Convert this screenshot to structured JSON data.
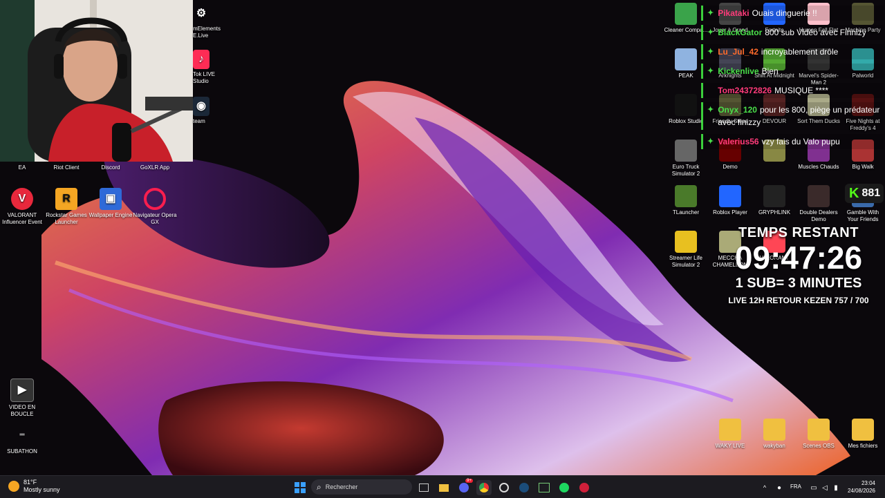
{
  "desktop_left_icons": [
    {
      "name": "ea-icon",
      "label": "EA",
      "color": "#ff4747"
    },
    {
      "name": "riot-client-icon",
      "label": "Riot Client",
      "color": "#e84040"
    },
    {
      "name": "discord-icon",
      "label": "Discord",
      "color": "#5865f2"
    },
    {
      "name": "goxlr-icon",
      "label": "GoXLR App",
      "color": "#222"
    },
    {
      "name": "valorant-influencer-icon",
      "label": "VALORANT Influencer Event",
      "color": "#ff4655"
    },
    {
      "name": "rockstar-icon",
      "label": "Rockstar Games Launcher",
      "color": "#f5a623"
    },
    {
      "name": "wallpaper-engine-icon",
      "label": "Wallpaper Engine",
      "color": "#2f6ad8"
    },
    {
      "name": "opera-gx-icon",
      "label": "Navigateur Opera GX",
      "color": "#fa1e4e"
    },
    {
      "name": "video-en-boucle-icon",
      "label": "VIDEO EN BOUCLE",
      "color": "#333"
    },
    {
      "name": "subathon-icon",
      "label": "SUBATHON",
      "color": "#222"
    }
  ],
  "desktop_partial_icons": [
    {
      "label": "mElements E.Live"
    },
    {
      "label": "Tok LIVE Studio"
    },
    {
      "label": "team"
    }
  ],
  "desktop_right_icons": [
    {
      "label": "Cleaner Compa...",
      "color": "#3aa34a"
    },
    {
      "label": "Jouer à Grand",
      "color": "#444"
    },
    {
      "label": "Fortnite",
      "color": "#2266ff"
    },
    {
      "label": "Human Fall Flat",
      "color": "#ffc0cb"
    },
    {
      "label": "Machine Party",
      "color": "#553"
    },
    {
      "label": "PEAK",
      "color": "#8fb3e0"
    },
    {
      "label": "Arknights",
      "color": "#445"
    },
    {
      "label": "Shift At Midnight",
      "color": "#5a3"
    },
    {
      "label": "Marvel's Spider-Man 2",
      "color": "#333"
    },
    {
      "label": "Palworld",
      "color": "#3aa"
    },
    {
      "label": "Roblox Studio",
      "color": "#111"
    },
    {
      "label": "Friendly Steps",
      "color": "#553"
    },
    {
      "label": "DEVOUR",
      "color": "#522"
    },
    {
      "label": "Sort Them Ducks",
      "color": "#aa8"
    },
    {
      "label": "Five Nights at Freddy's 4",
      "color": "#511"
    },
    {
      "label": "Euro Truck Simulator 2",
      "color": "#666"
    },
    {
      "label": "Demo",
      "color": "#600"
    },
    {
      "label": "",
      "color": "#884"
    },
    {
      "label": "Muscles Chauds",
      "color": "#803090"
    },
    {
      "label": "Big Walk",
      "color": "#a33"
    },
    {
      "label": "TLauncher",
      "color": "#4a7a2a"
    },
    {
      "label": "Roblox Player",
      "color": "#2266ff"
    },
    {
      "label": "GRYPHLINK",
      "color": "#222"
    },
    {
      "label": "Double Dealers Demo",
      "color": "#3a2a2a"
    },
    {
      "label": "Gamble With Your Friends",
      "color": "#3a6aaa"
    },
    {
      "label": "Streamer Life Simulator 2",
      "color": "#e8c020"
    },
    {
      "label": "MECCHA CHAMELEON",
      "color": "#aa7"
    },
    {
      "label": "VALORANT",
      "color": "#ff4655"
    }
  ],
  "chat": [
    {
      "user": "Pikataki",
      "color": "#ff3b7a",
      "text": "Ouais dinguerie !!"
    },
    {
      "user": "BlackGator",
      "color": "#4ae04a",
      "text": "800 sub Vidéo avec Finnizy"
    },
    {
      "user": "Lu_Jul_42",
      "color": "#ff6b2b",
      "text": "incroyablement drôle"
    },
    {
      "user": "Kickenlive",
      "color": "#4ae04a",
      "text": "Bien"
    },
    {
      "user": "Tom24372826",
      "color": "#ff3b7a",
      "text": "MUSIQUE ****"
    },
    {
      "user": "Onyx_120",
      "color": "#4ae04a",
      "text": "pour les 800, piège un prédateur avec finizzy"
    },
    {
      "user": "Valerius56",
      "color": "#ff3b7a",
      "text": "vzy fais du Valo pupu"
    }
  ],
  "kick": {
    "count": "881"
  },
  "timer": {
    "title": "TEMPS RESTANT",
    "time": "09:47:26",
    "rule": "1 SUB= 3 MINUTES",
    "subtitle": "LIVE 12H RETOUR KEZEN 757 / 700"
  },
  "bottom_folders": [
    {
      "label": "WAKY LIVE"
    },
    {
      "label": "wakyban"
    },
    {
      "label": "Scenes OBS"
    },
    {
      "label": "Mes fichiers"
    }
  ],
  "taskbar": {
    "weather_temp": "81°F",
    "weather_desc": "Mostly sunny",
    "search_placeholder": "Rechercher",
    "lang": "FRA",
    "time": "23:04",
    "date": "24/08/2026",
    "discord_badge": "9+"
  }
}
